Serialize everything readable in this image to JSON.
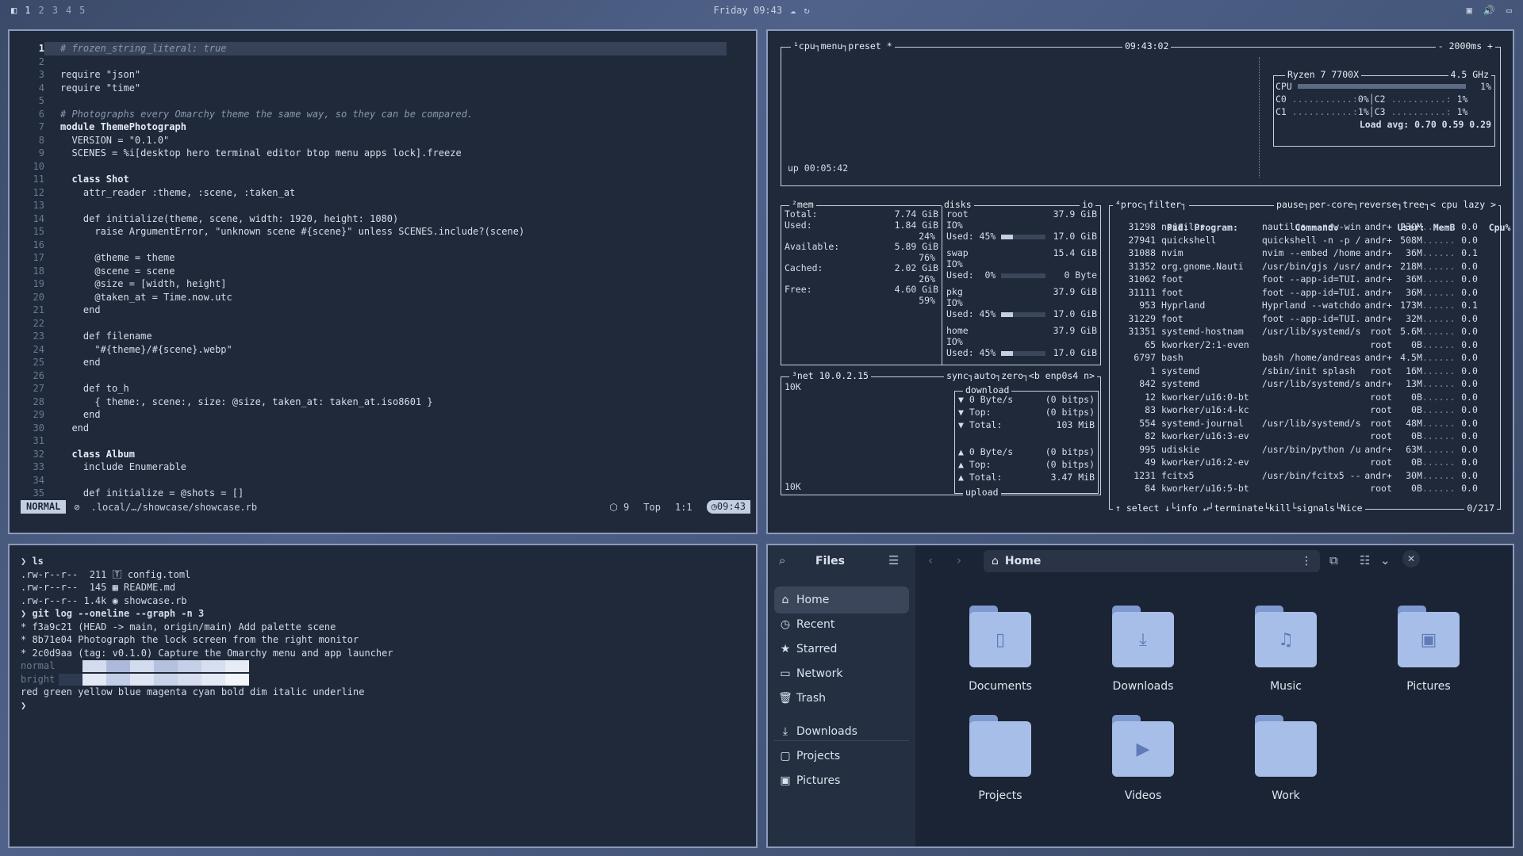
{
  "topbar": {
    "workspaces": [
      "1",
      "2",
      "3",
      "4",
      "5"
    ],
    "clock": "Friday 09:43"
  },
  "editor": {
    "lines": [
      {
        "n": "1",
        "t": "# frozen_string_literal: true",
        "k": "com",
        "hl": true
      },
      {
        "n": "2",
        "t": ""
      },
      {
        "n": "3",
        "t": "require \"json\""
      },
      {
        "n": "4",
        "t": "require \"time\""
      },
      {
        "n": "5",
        "t": ""
      },
      {
        "n": "6",
        "t": "# Photographs every Omarchy theme the same way, so they can be compared.",
        "k": "com"
      },
      {
        "n": "7",
        "t": "module ThemePhotograph",
        "k": "kw"
      },
      {
        "n": "8",
        "t": "  VERSION = \"0.1.0\""
      },
      {
        "n": "9",
        "t": "  SCENES = %i[desktop hero terminal editor btop menu apps lock].freeze"
      },
      {
        "n": "10",
        "t": ""
      },
      {
        "n": "11",
        "t": "  class Shot",
        "k": "kw"
      },
      {
        "n": "12",
        "t": "    attr_reader :theme, :scene, :taken_at"
      },
      {
        "n": "13",
        "t": ""
      },
      {
        "n": "14",
        "t": "    def initialize(theme, scene, width: 1920, height: 1080)"
      },
      {
        "n": "15",
        "t": "      raise ArgumentError, \"unknown scene #{scene}\" unless SCENES.include?(scene)"
      },
      {
        "n": "16",
        "t": ""
      },
      {
        "n": "17",
        "t": "      @theme = theme"
      },
      {
        "n": "18",
        "t": "      @scene = scene"
      },
      {
        "n": "19",
        "t": "      @size = [width, height]"
      },
      {
        "n": "20",
        "t": "      @taken_at = Time.now.utc"
      },
      {
        "n": "21",
        "t": "    end"
      },
      {
        "n": "22",
        "t": ""
      },
      {
        "n": "23",
        "t": "    def filename"
      },
      {
        "n": "24",
        "t": "      \"#{theme}/#{scene}.webp\""
      },
      {
        "n": "25",
        "t": "    end"
      },
      {
        "n": "26",
        "t": ""
      },
      {
        "n": "27",
        "t": "    def to_h"
      },
      {
        "n": "28",
        "t": "      { theme:, scene:, size: @size, taken_at: taken_at.iso8601 }"
      },
      {
        "n": "29",
        "t": "    end"
      },
      {
        "n": "30",
        "t": "  end"
      },
      {
        "n": "31",
        "t": ""
      },
      {
        "n": "32",
        "t": "  class Album",
        "k": "kw"
      },
      {
        "n": "33",
        "t": "    include Enumerable"
      },
      {
        "n": "34",
        "t": ""
      },
      {
        "n": "35",
        "t": "    def initialize = @shots = []"
      }
    ],
    "status": {
      "mode": "NORMAL",
      "path": ".local/…/showcase/showcase.rb",
      "count": "9",
      "pos": "Top",
      "cursor": "1:1",
      "time": "09:43"
    }
  },
  "btop": {
    "cpu_tabs": "¹cpu┐menu┐preset *",
    "time": "09:43:02",
    "interval": "- 2000ms +",
    "uptime": "up 00:05:42",
    "cpu_name": "Ryzen 7 7700X",
    "cpu_freq": "4.5 GHz",
    "cpu_total": "1%",
    "cores": [
      {
        "n": "C0",
        "v": "0%"
      },
      {
        "n": "C2",
        "v": "1%"
      },
      {
        "n": "C1",
        "v": "1%"
      },
      {
        "n": "C3",
        "v": "1%"
      }
    ],
    "load_avg": "Load avg: 0.70 0.59 0.29",
    "mem": {
      "title": "²mem",
      "rows": [
        {
          "l": "Total:",
          "v": "7.74 GiB"
        },
        {
          "l": "Used:",
          "v": "1.84 GiB",
          "p": "24%"
        },
        {
          "l": "Available:",
          "v": "5.89 GiB",
          "p": "76%"
        },
        {
          "l": "Cached:",
          "v": "2.02 GiB",
          "p": "26%"
        },
        {
          "l": "Free:",
          "v": "4.60 GiB",
          "p": "59%"
        }
      ]
    },
    "disks": {
      "title": "disks",
      "io": "io",
      "items": [
        {
          "name": "root",
          "size": "37.9 GiB",
          "used": "Used: 45%",
          "usedv": "17.0 GiB",
          "frac": 0.45
        },
        {
          "name": "swap",
          "size": "15.4 GiB",
          "used": "Used:  0%",
          "usedv": "0 Byte",
          "frac": 0.0
        },
        {
          "name": "pkg",
          "size": "37.9 GiB",
          "used": "Used: 45%",
          "usedv": "17.0 GiB",
          "frac": 0.45
        },
        {
          "name": "home",
          "size": "37.9 GiB",
          "used": "Used: 45%",
          "usedv": "17.0 GiB",
          "frac": 0.45
        }
      ],
      "io_label": "IO%"
    },
    "net": {
      "title": "³net 10.0.2.15",
      "tabs": "sync┐auto┐zero┐<b enp0s4 n>",
      "scale_top": "10K",
      "scale_bottom": "10K",
      "download": "download",
      "upload": "upload",
      "down": [
        {
          "l": "▼ 0 Byte/s",
          "v": "(0 bitps)"
        },
        {
          "l": "▼ Top:",
          "v": "(0 bitps)"
        },
        {
          "l": "▼ Total:",
          "v": "103 MiB"
        }
      ],
      "up": [
        {
          "l": "▲ 0 Byte/s",
          "v": "(0 bitps)"
        },
        {
          "l": "▲ Top:",
          "v": "(0 bitps)"
        },
        {
          "l": "▲ Total:",
          "v": "3.47 MiB"
        }
      ]
    },
    "proc": {
      "title": "⁴proc┐filter┐",
      "options": "pause┐per-core┐reverse┐tree┐< cpu lazy >",
      "header": {
        "pid": "Pid:",
        "prog": "Program:",
        "cmd": "Command:",
        "user": "User:",
        "mem": "MemB",
        "cpu": "Cpu%"
      },
      "rows": [
        [
          "31298",
          "nautilus",
          "nautilus --new-win",
          "andr+",
          "230M",
          "0.0"
        ],
        [
          "27941",
          "quickshell",
          "quickshell -n -p /",
          "andr+",
          "508M",
          "0.0"
        ],
        [
          "31088",
          "nvim",
          "nvim --embed /home",
          "andr+",
          "36M",
          "0.1"
        ],
        [
          "31352",
          "org.gnome.Nauti",
          "/usr/bin/gjs /usr/",
          "andr+",
          "218M",
          "0.0"
        ],
        [
          "31062",
          "foot",
          "foot --app-id=TUI.",
          "andr+",
          "36M",
          "0.0"
        ],
        [
          "31111",
          "foot",
          "foot --app-id=TUI.",
          "andr+",
          "36M",
          "0.0"
        ],
        [
          "953",
          "Hyprland",
          "Hyprland --watchdo",
          "andr+",
          "173M",
          "0.1"
        ],
        [
          "31229",
          "foot",
          "foot --app-id=TUI.",
          "andr+",
          "32M",
          "0.0"
        ],
        [
          "31351",
          "systemd-hostnam",
          "/usr/lib/systemd/s",
          "root",
          "5.6M",
          "0.0"
        ],
        [
          "65",
          "kworker/2:1-even",
          "",
          "root",
          "0B",
          "0.0"
        ],
        [
          "6797",
          "bash",
          "bash /home/andreas",
          "andr+",
          "4.5M",
          "0.0"
        ],
        [
          "1",
          "systemd",
          "/sbin/init splash",
          "root",
          "16M",
          "0.0"
        ],
        [
          "842",
          "systemd",
          "/usr/lib/systemd/s",
          "andr+",
          "13M",
          "0.0"
        ],
        [
          "12",
          "kworker/u16:0-bt",
          "",
          "root",
          "0B",
          "0.0"
        ],
        [
          "83",
          "kworker/u16:4-kc",
          "",
          "root",
          "0B",
          "0.0"
        ],
        [
          "554",
          "systemd-journal",
          "/usr/lib/systemd/s",
          "root",
          "48M",
          "0.0"
        ],
        [
          "82",
          "kworker/u16:3-ev",
          "",
          "root",
          "0B",
          "0.0"
        ],
        [
          "995",
          "udiskie",
          "/usr/bin/python /u",
          "andr+",
          "63M",
          "0.0"
        ],
        [
          "49",
          "kworker/u16:2-ev",
          "",
          "root",
          "0B",
          "0.0"
        ],
        [
          "1231",
          "fcitx5",
          "/usr/bin/fcitx5 --",
          "andr+",
          "30M",
          "0.0"
        ],
        [
          "84",
          "kworker/u16:5-bt",
          "",
          "root",
          "0B",
          "0.0"
        ]
      ],
      "footer": "↑ select ↓└info ↵┘terminate└kill└signals└Nice",
      "count": "0/217"
    }
  },
  "terminal": {
    "lines": [
      {
        "t": "❯ ls",
        "b": true
      },
      {
        "t": ".rw-r--r--  211 🅃 config.toml"
      },
      {
        "t": ".rw-r--r--  145 ▦ README.md"
      },
      {
        "t": ".rw-r--r-- 1.4k ◉ showcase.rb"
      },
      {
        "t": "❯ git log --oneline --graph -n 3",
        "b": true
      },
      {
        "t": "* f3a9c21 (HEAD -> main, origin/main) Add palette scene"
      },
      {
        "t": "* 8b71e04 Photograph the lock screen from the right monitor"
      },
      {
        "t": "* 2c0d9aa (tag: v0.1.0) Capture the Omarchy menu and app launcher"
      },
      {
        "t": "normal"
      },
      {
        "t": "bright"
      },
      {
        "t": "red green yellow blue magenta cyan bold dim italic underline"
      },
      {
        "t": "❯"
      }
    ],
    "swatches_normal": [
      "#1f2939",
      "#d3dcef",
      "#aebadb",
      "#d3dcef",
      "#b4c1de",
      "#c5d0e8",
      "#d6def0",
      "#e6ebf5"
    ],
    "swatches_bright": [
      "#2e3a50",
      "#e2e8f4",
      "#c2cde6",
      "#dfe5f2",
      "#c9d3ea",
      "#d5ddef",
      "#e3e9f5",
      "#f2f5fa"
    ]
  },
  "files": {
    "title": "Files",
    "location": "Home",
    "sidebar": [
      {
        "icon": "⌂",
        "label": "Home",
        "active": true
      },
      {
        "icon": "◷",
        "label": "Recent"
      },
      {
        "icon": "★",
        "label": "Starred"
      },
      {
        "icon": "▭",
        "label": "Network"
      },
      {
        "icon": "🗑",
        "label": "Trash"
      },
      {
        "icon": "⤓",
        "label": "Downloads"
      },
      {
        "icon": "▢",
        "label": "Projects"
      },
      {
        "icon": "▣",
        "label": "Pictures"
      }
    ],
    "folders": [
      {
        "label": "Documents",
        "glyph": "▯"
      },
      {
        "label": "Downloads",
        "glyph": "⤓"
      },
      {
        "label": "Music",
        "glyph": "♫"
      },
      {
        "label": "Pictures",
        "glyph": "▣"
      },
      {
        "label": "Projects",
        "glyph": ""
      },
      {
        "label": "Videos",
        "glyph": "▶"
      },
      {
        "label": "Work",
        "glyph": ""
      }
    ]
  }
}
